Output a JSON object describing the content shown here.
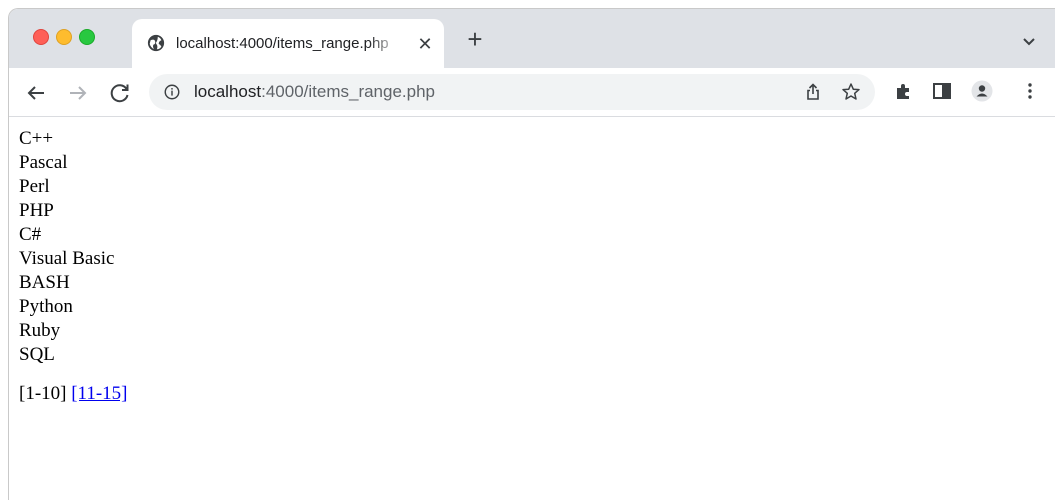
{
  "tab": {
    "title": "localhost:4000/items_range.php",
    "close_icon": "close-icon",
    "favicon": "globe-icon"
  },
  "toolbar": {
    "url_host": "localhost",
    "url_rest": ":4000/items_range.php"
  },
  "items": [
    "C++",
    "Pascal",
    "Perl",
    "PHP",
    "C#",
    "Visual Basic",
    "BASH",
    "Python",
    "Ruby",
    "SQL"
  ],
  "pager": {
    "current": "[1-10]",
    "next_link": "[11-15]"
  },
  "colors": {
    "tabstrip": "#dee1e6",
    "omnibox": "#f1f3f4",
    "link": "#0000ee",
    "traffic_red": "#fe5f57",
    "traffic_yellow": "#febc2e",
    "traffic_green": "#28c840"
  }
}
